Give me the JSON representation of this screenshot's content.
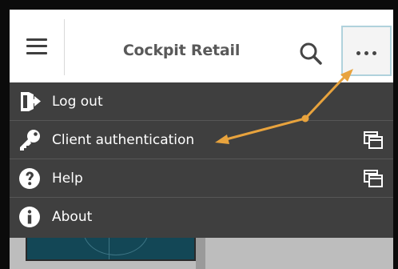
{
  "header": {
    "title": "Cockpit Retail",
    "menu_icon": "hamburger-menu-icon",
    "search_icon": "search-icon",
    "more_icon": "more-horizontal-icon"
  },
  "menu": {
    "items": [
      {
        "label": "Log out",
        "icon": "log-out-icon",
        "right_icon": null
      },
      {
        "label": "Client authentication",
        "icon": "key-icon",
        "right_icon": "open-in-window-icon"
      },
      {
        "label": "Help",
        "icon": "help-icon",
        "right_icon": "open-in-window-icon"
      },
      {
        "label": "About",
        "icon": "info-icon",
        "right_icon": null
      }
    ]
  },
  "colors": {
    "menu_background": "#3f3f3f",
    "menu_text": "#ffffff",
    "annotation_arrow": "#e8a33d",
    "more_button_border": "#b0d2dc"
  }
}
